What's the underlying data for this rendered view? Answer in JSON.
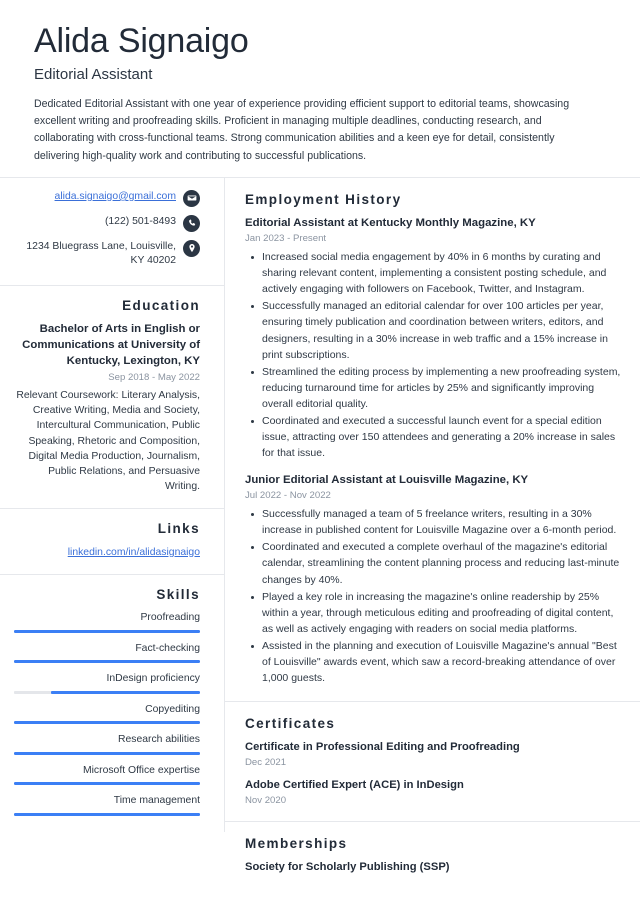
{
  "header": {
    "name": "Alida Signaigo",
    "job_title": "Editorial Assistant",
    "summary": "Dedicated Editorial Assistant with one year of experience providing efficient support to editorial teams, showcasing excellent writing and proofreading skills. Proficient in managing multiple deadlines, conducting research, and collaborating with cross-functional teams. Strong communication abilities and a keen eye for detail, consistently delivering high-quality work and contributing to successful publications."
  },
  "theme": {
    "accent_blue": "#3b7ff5",
    "link_blue": "#3a6fd8",
    "icon_badge": "#2b3644",
    "heading": "#222b38",
    "muted": "#8b94a1",
    "divider": "#e6e8ec"
  },
  "contact": {
    "email": "alida.signaigo@gmail.com",
    "email_icon": "envelope-icon",
    "phone": "(122) 501-8493",
    "phone_icon": "phone-icon",
    "address": "1234 Bluegrass Lane, Louisville, KY 40202",
    "address_icon": "location-pin-icon"
  },
  "education": {
    "title": "Education",
    "degree": "Bachelor of Arts in English or Communications at University of Kentucky, Lexington, KY",
    "date": "Sep 2018 - May 2022",
    "description": "Relevant Coursework: Literary Analysis, Creative Writing, Media and Society, Intercultural Communication, Public Speaking, Rhetoric and Composition, Digital Media Production, Journalism, Public Relations, and Persuasive Writing."
  },
  "links": {
    "title": "Links",
    "items": [
      {
        "label": "linkedin.com/in/alidasignaigo"
      }
    ]
  },
  "skills": {
    "title": "Skills",
    "items": [
      {
        "label": "Proofreading",
        "level": 100
      },
      {
        "label": "Fact-checking",
        "level": 100
      },
      {
        "label": "InDesign proficiency",
        "level": 80
      },
      {
        "label": "Copyediting",
        "level": 100
      },
      {
        "label": "Research abilities",
        "level": 100
      },
      {
        "label": "Microsoft Office expertise",
        "level": 100
      },
      {
        "label": "Time management",
        "level": 100
      }
    ]
  },
  "employment": {
    "title": "Employment History",
    "jobs": [
      {
        "heading": "Editorial Assistant at Kentucky Monthly Magazine, KY",
        "date": "Jan 2023 - Present",
        "bullets": [
          "Increased social media engagement by 40% in 6 months by curating and sharing relevant content, implementing a consistent posting schedule, and actively engaging with followers on Facebook, Twitter, and Instagram.",
          "Successfully managed an editorial calendar for over 100 articles per year, ensuring timely publication and coordination between writers, editors, and designers, resulting in a 30% increase in web traffic and a 15% increase in print subscriptions.",
          "Streamlined the editing process by implementing a new proofreading system, reducing turnaround time for articles by 25% and significantly improving overall editorial quality.",
          "Coordinated and executed a successful launch event for a special edition issue, attracting over 150 attendees and generating a 20% increase in sales for that issue."
        ]
      },
      {
        "heading": "Junior Editorial Assistant at Louisville Magazine, KY",
        "date": "Jul 2022 - Nov 2022",
        "bullets": [
          "Successfully managed a team of 5 freelance writers, resulting in a 30% increase in published content for Louisville Magazine over a 6-month period.",
          "Coordinated and executed a complete overhaul of the magazine's editorial calendar, streamlining the content planning process and reducing last-minute changes by 40%.",
          "Played a key role in increasing the magazine's online readership by 25% within a year, through meticulous editing and proofreading of digital content, as well as actively engaging with readers on social media platforms.",
          "Assisted in the planning and execution of Louisville Magazine's annual \"Best of Louisville\" awards event, which saw a record-breaking attendance of over 1,000 guests."
        ]
      }
    ]
  },
  "certificates": {
    "title": "Certificates",
    "items": [
      {
        "name": "Certificate in Professional Editing and Proofreading",
        "date": "Dec 2021"
      },
      {
        "name": "Adobe Certified Expert (ACE) in InDesign",
        "date": "Nov 2020"
      }
    ]
  },
  "memberships": {
    "title": "Memberships",
    "items": [
      {
        "name": "Society for Scholarly Publishing (SSP)"
      }
    ]
  }
}
